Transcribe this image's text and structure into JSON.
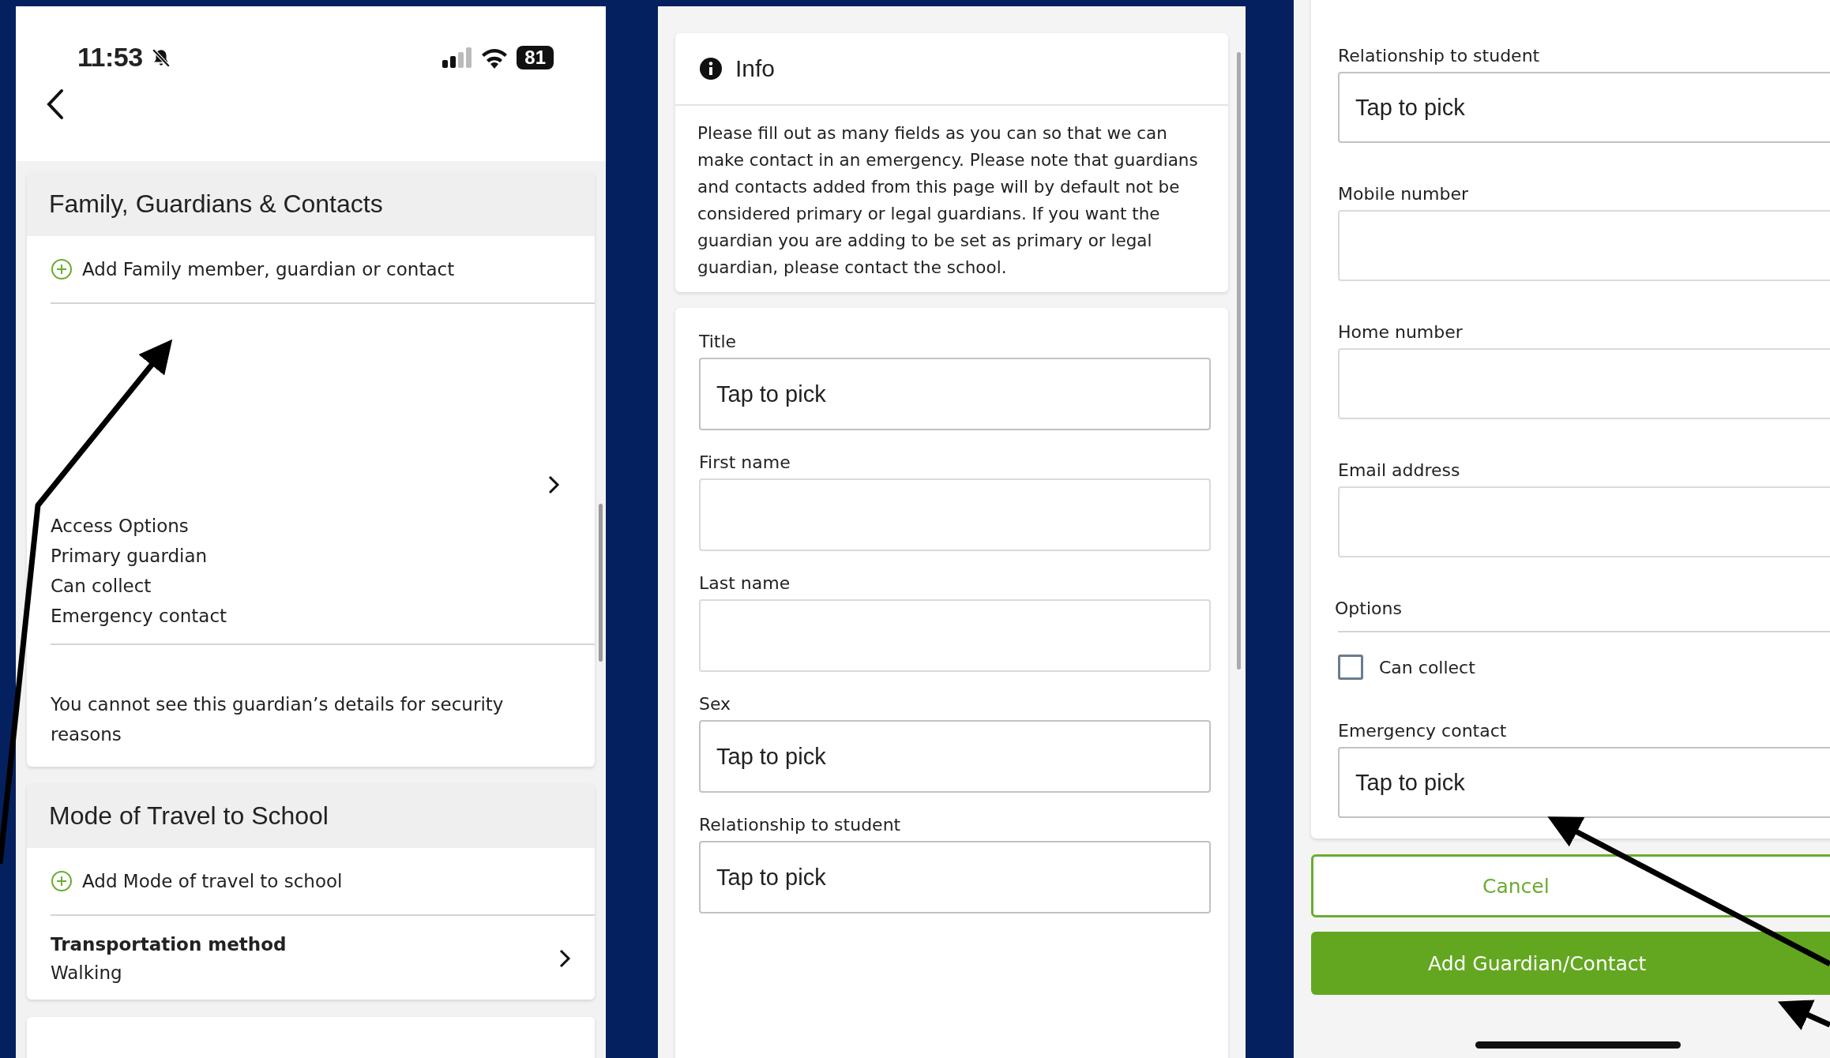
{
  "profile_screen": {
    "status_bar": {
      "time": "11:53",
      "battery": "81"
    },
    "family_section": {
      "title": "Family, Guardians & Contacts",
      "add_label": "Add Family member, guardian or contact",
      "guardian_options": [
        "Access Options",
        "Primary guardian",
        "Can collect",
        "Emergency contact"
      ],
      "hidden_notice": "You cannot see this guardian’s details for security reasons"
    },
    "travel_section": {
      "title": "Mode of Travel to School",
      "add_label": "Add Mode of travel to school",
      "rows": [
        {
          "label": "Transportation method",
          "value": "Walking"
        }
      ]
    }
  },
  "form_screen": {
    "info": {
      "title": "Info",
      "text": "Please fill out as many fields as you can so that we can make contact in an emergency. Please note that guardians and contacts added from this page will by default not be considered primary or legal guardians. If you want the guardian you are adding to be set as primary or legal guardian, please contact the school."
    },
    "fields": [
      {
        "label": "Title",
        "kind": "picker",
        "value": "Tap to pick"
      },
      {
        "label": "First name",
        "kind": "text"
      },
      {
        "label": "Last name",
        "kind": "text"
      },
      {
        "label": "Sex",
        "kind": "picker",
        "value": "Tap to pick"
      },
      {
        "label": "Relationship to student",
        "kind": "picker",
        "value": "Tap to pick"
      }
    ]
  },
  "form_screen_continued": {
    "fields": [
      {
        "label": "Relationship to student",
        "kind": "picker",
        "value": "Tap to pick"
      },
      {
        "label": "Mobile number",
        "kind": "text"
      },
      {
        "label": "Home number",
        "kind": "text"
      },
      {
        "label": "Email address",
        "kind": "text"
      }
    ],
    "options": {
      "title": "Options",
      "checkboxes": [
        {
          "label": "Can collect",
          "checked": false
        }
      ]
    },
    "fields_after": [
      {
        "label": "Emergency contact",
        "kind": "picker",
        "value": "Tap to pick"
      }
    ],
    "buttons": [
      {
        "label": "Cancel",
        "kind": "secondary"
      },
      {
        "label": "Add Guardian/Contact",
        "kind": "primary"
      }
    ]
  }
}
